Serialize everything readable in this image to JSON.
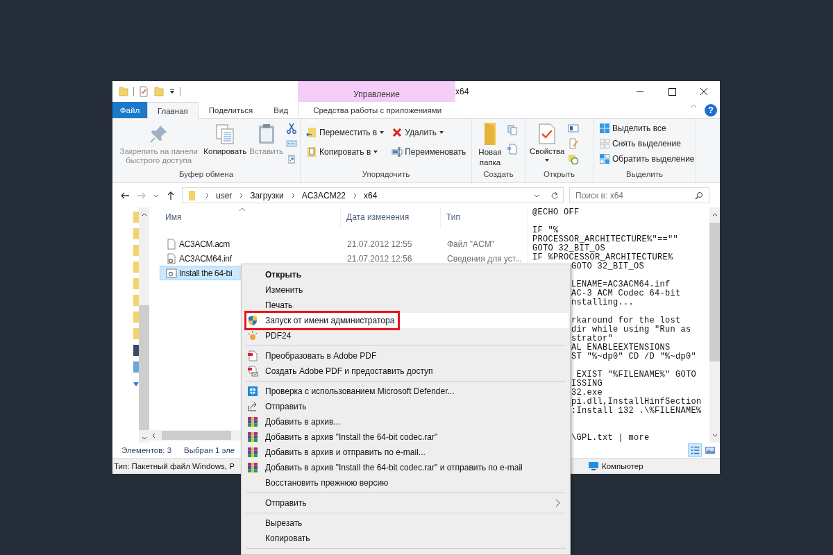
{
  "window": {
    "title": "x64",
    "context_tab": "Управление"
  },
  "ribbon_tabs": [
    {
      "label": "Файл",
      "kind": "file",
      "selected": false
    },
    {
      "label": "Главная",
      "kind": "tab",
      "selected": true
    },
    {
      "label": "Поделиться",
      "kind": "tab",
      "selected": false
    },
    {
      "label": "Вид",
      "kind": "tab",
      "selected": false
    },
    {
      "label": "Средства работы с приложениями",
      "kind": "context",
      "selected": false
    }
  ],
  "help_label": "?",
  "ribbon_groups": [
    {
      "kind": "clipboard",
      "label": "Буфер обмена",
      "buttons": [
        {
          "label": "Закрепить на панели быстрого доступа",
          "kind": "pin",
          "disabled": true,
          "dropdown": false
        },
        {
          "label": "Копировать",
          "kind": "copy",
          "disabled": false,
          "dropdown": false
        },
        {
          "label": "Вставить",
          "kind": "paste",
          "disabled": true,
          "dropdown": false
        }
      ]
    },
    {
      "kind": "organize",
      "label": "Упорядочить",
      "buttons": [
        {
          "label": "Переместить в",
          "kind": "move",
          "disabled": false,
          "dropdown": true
        },
        {
          "label": "Копировать в",
          "kind": "copyto",
          "disabled": false,
          "dropdown": true
        },
        {
          "label": "Удалить",
          "kind": "delete",
          "disabled": false,
          "dropdown": true
        },
        {
          "label": "Переименовать",
          "kind": "rename",
          "disabled": false,
          "dropdown": false
        }
      ]
    },
    {
      "kind": "new",
      "label": "Создать",
      "buttons": [
        {
          "label": "Новая папка",
          "kind": "folder",
          "disabled": false,
          "dropdown": false
        }
      ]
    },
    {
      "kind": "open",
      "label": "Открыть",
      "buttons": [
        {
          "label": "Свойства",
          "kind": "properties",
          "disabled": false,
          "dropdown": true
        }
      ]
    },
    {
      "kind": "select",
      "label": "Выделить",
      "buttons": [
        {
          "label": "Выделить все",
          "kind": "all",
          "disabled": false,
          "dropdown": false
        },
        {
          "label": "Снять выделение",
          "kind": "none",
          "disabled": false,
          "dropdown": false
        },
        {
          "label": "Обратить выделение",
          "kind": "invert",
          "disabled": false,
          "dropdown": false
        }
      ]
    }
  ],
  "address": {
    "path": [
      "user",
      "Загрузки",
      "AC3ACM22",
      "x64"
    ],
    "search_placeholder": "Поиск в: x64"
  },
  "file_list": {
    "columns": [
      "Имя",
      "Дата изменения",
      "Тип"
    ],
    "rows": [
      {
        "name": "AC3ACM.acm",
        "date": "21.07.2012 12:55",
        "type": "Файл \"ACM\"",
        "kind": "file",
        "selected": false
      },
      {
        "name": "AC3ACM64.inf",
        "date": "21.07.2012 12:56",
        "type": "Сведения для уст...",
        "kind": "setup",
        "selected": false
      },
      {
        "name": "Install the 64-bi",
        "kind": "batch",
        "selected": true
      }
    ]
  },
  "preview": [
    {
      "kind": "full",
      "text": "@ECHO OFF"
    },
    {
      "kind": "blank"
    },
    {
      "kind": "full",
      "text": "IF \"%"
    },
    {
      "kind": "full",
      "text": "PROCESSOR_ARCHITECTURE%\"==\"\""
    },
    {
      "kind": "full",
      "text": "GOTO 32_BIT_OS"
    },
    {
      "kind": "full",
      "text": "IF %PROCESSOR_ARCHITECTURE%"
    },
    {
      "kind": "clipped",
      "text": "GOTO 32_BIT_OS"
    },
    {
      "kind": "blank"
    },
    {
      "kind": "clipped",
      "text": "LENAME=AC3ACM64.inf"
    },
    {
      "kind": "clipped",
      "text": "AC-3 ACM Codec 64-bit"
    },
    {
      "kind": "clipped",
      "text": "nstalling..."
    },
    {
      "kind": "blank"
    },
    {
      "kind": "clipped",
      "text": "rkaround for the lost"
    },
    {
      "kind": "clipped",
      "text": "dir while using \"Run as"
    },
    {
      "kind": "clipped",
      "text": "strator\""
    },
    {
      "kind": "clipped",
      "text": "AL ENABLEEXTENSIONS"
    },
    {
      "kind": "clipped",
      "text": "ST \"%~dp0\" CD /D \"%~dp0\""
    },
    {
      "kind": "blank"
    },
    {
      "kind": "clipped",
      "text": " EXIST \"%FILENAME%\" GOTO"
    },
    {
      "kind": "clipped",
      "text": "ISSING"
    },
    {
      "kind": "clipped",
      "text": "32.exe"
    },
    {
      "kind": "clipped",
      "text": "pi.dll,InstallHinfSection"
    },
    {
      "kind": "clipped",
      "text": ":Install 132 .\\%FILENAME%"
    },
    {
      "kind": "blank"
    },
    {
      "kind": "blank"
    },
    {
      "kind": "clipped",
      "text": "\\GPL.txt | more"
    }
  ],
  "status": {
    "count": "Элементов: 3",
    "selection": "Выбран 1 эле",
    "views": [
      {
        "kind": "details",
        "selected": true
      },
      {
        "kind": "preview",
        "selected": false
      }
    ]
  },
  "info_bar": {
    "type_text": "Тип: Пакетный файл Windows, Р",
    "location": "Компьютер"
  },
  "context_menu": [
    {
      "kind": "plain",
      "label": "Открыть",
      "default": true,
      "highlighted": false
    },
    {
      "kind": "plain",
      "label": "Изменить",
      "default": false,
      "highlighted": false
    },
    {
      "kind": "plain",
      "label": "Печать",
      "default": false,
      "highlighted": false
    },
    {
      "kind": "admin",
      "label": "Запуск от имени администратора",
      "default": false,
      "highlighted": true
    },
    {
      "kind": "pdf24",
      "label": "PDF24",
      "default": false,
      "highlighted": false
    },
    {
      "kind": "separator"
    },
    {
      "kind": "adobe-convert",
      "label": "Преобразовать в Adobe PDF",
      "default": false,
      "highlighted": false
    },
    {
      "kind": "adobe-share",
      "label": "Создать Adobe PDF и предоставить доступ",
      "default": false,
      "highlighted": false
    },
    {
      "kind": "separator"
    },
    {
      "kind": "scan",
      "label": "Проверка с использованием Microsoft Defender...",
      "default": false,
      "highlighted": false
    },
    {
      "kind": "share",
      "label": "Отправить",
      "default": false,
      "highlighted": false
    },
    {
      "kind": "archive",
      "label": "Добавить в архив...",
      "default": false,
      "highlighted": false
    },
    {
      "kind": "archive",
      "label": "Добавить в архив \"Install the 64-bit codec.rar\"",
      "default": false,
      "highlighted": false
    },
    {
      "kind": "archive",
      "label": "Добавить в архив и отправить по e-mail...",
      "default": false,
      "highlighted": false
    },
    {
      "kind": "archive",
      "label": "Добавить в архив \"Install the 64-bit codec.rar\" и отправить по e-mail",
      "default": false,
      "highlighted": false
    },
    {
      "kind": "plain",
      "label": "Восстановить прежнюю версию",
      "default": false,
      "highlighted": false
    },
    {
      "kind": "separator"
    },
    {
      "kind": "submenu",
      "label": "Отправить",
      "default": false,
      "highlighted": false
    },
    {
      "kind": "separator"
    },
    {
      "kind": "plain",
      "label": "Вырезать",
      "default": false,
      "highlighted": false
    },
    {
      "kind": "plain",
      "label": "Копировать",
      "default": false,
      "highlighted": false
    },
    {
      "kind": "separator"
    }
  ]
}
